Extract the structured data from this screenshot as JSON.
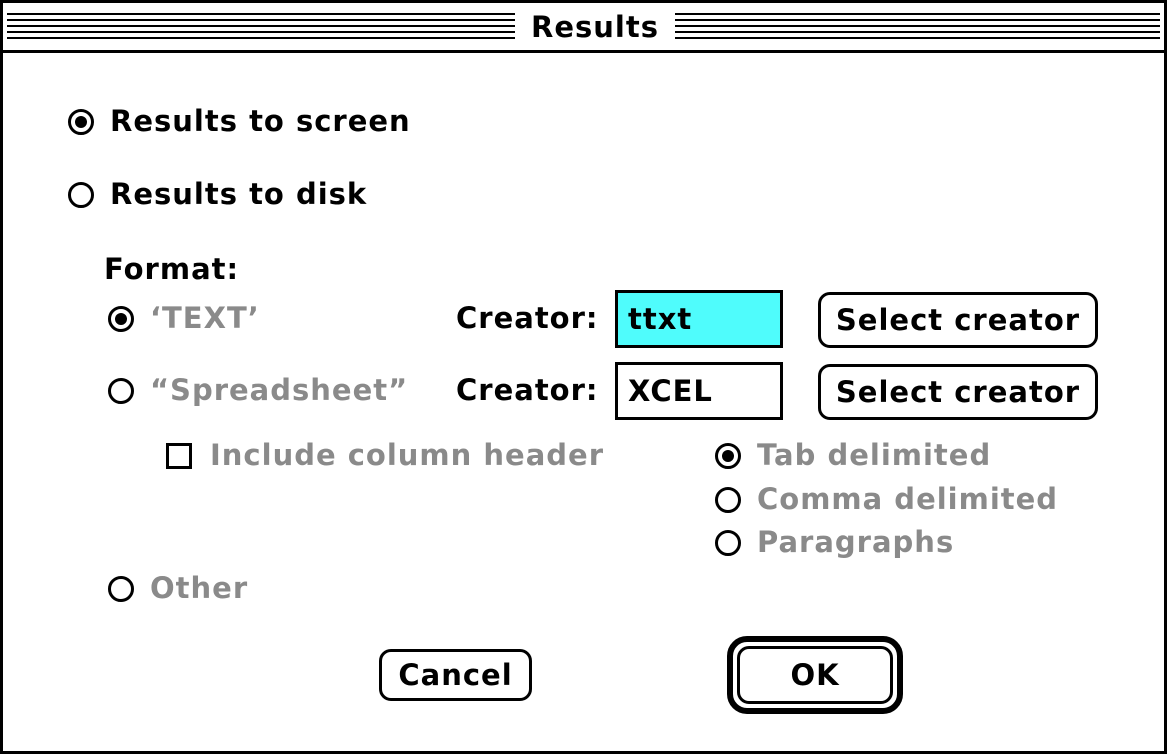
{
  "window": {
    "title": "Results"
  },
  "output": {
    "screen_label": "Results to screen",
    "disk_label": "Results to disk",
    "selected": "Results to screen"
  },
  "format": {
    "heading": "Format:",
    "text_label": "‘TEXT’",
    "spreadsheet_label": "“Spreadsheet”",
    "other_label": "Other",
    "selected": "‘TEXT’",
    "creator_label": "Creator:",
    "text_creator": "ttxt",
    "spreadsheet_creator": "XCEL",
    "select_creator_label": "Select creator"
  },
  "spreadsheet_options": {
    "include_header_label": "Include column header",
    "include_header_checked": false,
    "delimiters": [
      "Tab delimited",
      "Comma delimited",
      "Paragraphs"
    ],
    "selected_delimiter": "Tab delimited"
  },
  "buttons": {
    "cancel": "Cancel",
    "ok": "OK",
    "default": "OK"
  },
  "colors": {
    "field_selection": "#4ffcfc",
    "disabled_text": "#8a8a8a"
  }
}
